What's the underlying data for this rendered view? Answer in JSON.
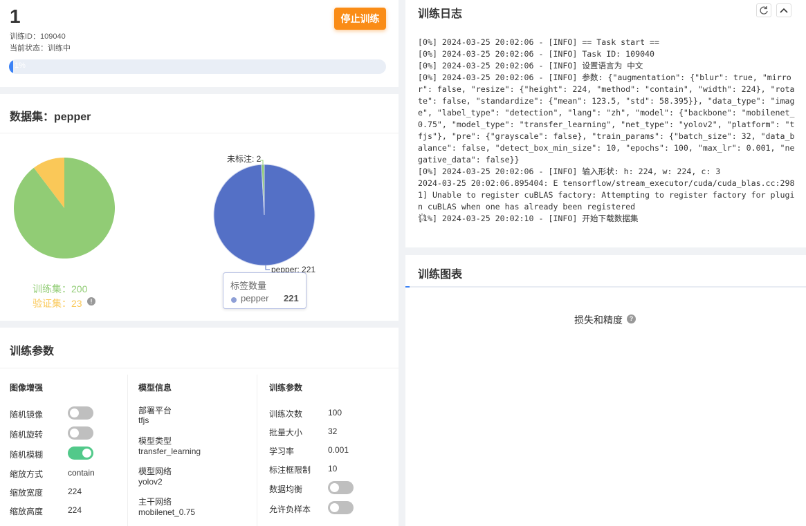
{
  "task": {
    "number": "1",
    "id_line": "训练ID：109040",
    "status_line": "当前状态：训练中",
    "stop_label": "停止训练",
    "progress": 1,
    "progress_text": "1%"
  },
  "dataset": {
    "title": "数据集：pepper",
    "train_label": "训练集：200",
    "val_label": "验证集：23",
    "colors": {
      "train": "#91cc75",
      "val": "#fac858",
      "label_main": "#5470c6",
      "label_unmarked": "#91cc75"
    },
    "tooltip": {
      "title": "标签数量",
      "name": "pepper",
      "value": "221"
    },
    "ghost_label": "标签数量"
  },
  "chart_data": [
    {
      "type": "pie",
      "categories": [
        "训练集",
        "验证集"
      ],
      "values": [
        200,
        23
      ]
    },
    {
      "type": "pie",
      "categories": [
        "pepper",
        "未标注"
      ],
      "values": [
        221,
        2
      ],
      "data_labels": [
        "pepper: 221",
        "未标注: 2"
      ]
    }
  ],
  "params": {
    "title": "训练参数",
    "image_aug": {
      "heading": "图像增强",
      "mirror": "随机镜像",
      "rotate": "随机旋转",
      "blur": "随机模糊",
      "resize_method_label": "缩放方式",
      "resize_method_value": "contain",
      "resize_width_label": "缩放宽度",
      "resize_width_value": "224",
      "resize_height_label": "缩放高度",
      "resize_height_value": "224",
      "mirror_on": false,
      "rotate_on": false,
      "blur_on": true
    },
    "model": {
      "heading": "模型信息",
      "platform_label": "部署平台",
      "platform_value": "tfjs",
      "type_label": "模型类型",
      "type_value": "transfer_learning",
      "net_label": "模型网络",
      "net_value": "yolov2",
      "backbone_label": "主干网络",
      "backbone_value": "mobilenet_0.75"
    },
    "train": {
      "heading": "训练参数",
      "epochs_label": "训练次数",
      "epochs_value": "100",
      "batch_label": "批量大小",
      "batch_value": "32",
      "lr_label": "学习率",
      "lr_value": "0.001",
      "bbox_label": "标注框限制",
      "bbox_value": "10",
      "balance_label": "数据均衡",
      "negative_label": "允许负样本",
      "balance_on": false,
      "negative_on": false
    }
  },
  "log": {
    "title": "训练日志",
    "lines": [
      "[0%] 2024-03-25 20:02:06 - [INFO] == Task start ==",
      "[0%] 2024-03-25 20:02:06 - [INFO] Task ID: 109040",
      "[0%] 2024-03-25 20:02:06 - [INFO] 设置语言为 中文",
      "[0%] 2024-03-25 20:02:06 - [INFO] 参数: {\"augmentation\": {\"blur\": true, \"mirror\": false, \"resize\": {\"height\": 224, \"method\": \"contain\", \"width\": 224}, \"rotate\": false, \"standardize\": {\"mean\": 123.5, \"std\": 58.395}}, \"data_type\": \"image\", \"label_type\": \"detection\", \"lang\": \"zh\", \"model\": {\"backbone\": \"mobilenet_0.75\", \"model_type\": \"transfer_learning\", \"net_type\": \"yolov2\", \"platform\": \"tfjs\"}, \"pre\": {\"grayscale\": false}, \"train_params\": {\"batch_size\": 32, \"data_balance\": false, \"detect_box_min_size\": 10, \"epochs\": 100, \"max_lr\": 0.001, \"negative_data\": false}}",
      "[0%] 2024-03-25 20:02:06 - [INFO] 输入形状: h: 224, w: 224, c: 3",
      "2024-03-25 20:02:06.895404: E tensorflow/stream_executor/cuda/cuda_blas.cc:2981] Unable to register cuBLAS factory: Attempting to register factory for plugin cuBLAS when one has already been registered",
      "[1%] 2024-03-25 20:02:10 - [INFO] 开始下载数据集"
    ]
  },
  "chart_panel": {
    "title": "训练图表",
    "chart_title": "损失和精度"
  }
}
